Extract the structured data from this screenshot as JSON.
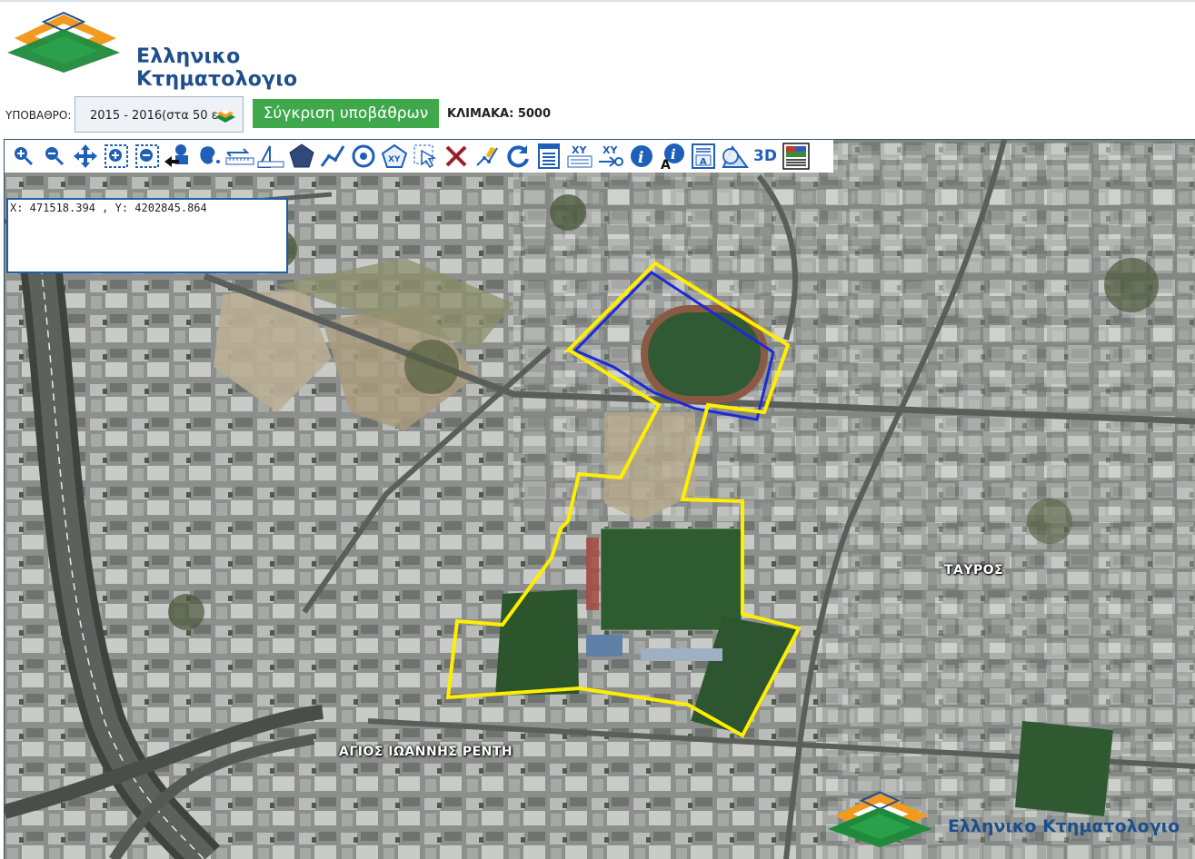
{
  "brand": {
    "name": "Ελληνικο Κτηματολογιο"
  },
  "basemap": {
    "label": "ΥΠΟΒΑΘΡΟ:",
    "value": "2015 - 2016(στα 50 ε"
  },
  "compare_button": "Σύγκριση υποβάθρων",
  "scale": "ΚΛΙΜΑΚΑ: 5000",
  "toolbar": {
    "tools": [
      "zoom-in-icon",
      "zoom-out-icon",
      "pan-icon",
      "zoom-box-in-icon",
      "zoom-box-out-icon",
      "back-arrow-icon",
      "full-extent-icon",
      "measure-distance-icon",
      "measure-area-icon",
      "polygon-icon",
      "line-icon",
      "point-icon",
      "xy-polygon-icon",
      "select-icon",
      "clear-icon",
      "edit-vertex-icon",
      "refresh-icon",
      "list-icon",
      "xy-input-icon",
      "xy-goto-icon",
      "info-icon",
      "info-text-icon",
      "legend-icon",
      "spatial-query-icon",
      "3d-icon",
      "print-icon"
    ],
    "label_3d": "3D"
  },
  "coordinates": "X: 471518.394 , Y: 4202845.864",
  "places": {
    "tavros": "ΤΑΥΡΟΣ",
    "agios_ioannis_renti": "ΑΓΙΟΣ ΙΩΑΝΝΗΣ ΡΕΝΤΗ"
  },
  "colors": {
    "parcel_outline": "#ffee00",
    "selected_outline": "#1e2ad6",
    "compare_button": "#3fa84a",
    "brand_blue": "#1d4f8c",
    "logo_green": "#1f8a3b",
    "logo_orange": "#f29a1f"
  }
}
